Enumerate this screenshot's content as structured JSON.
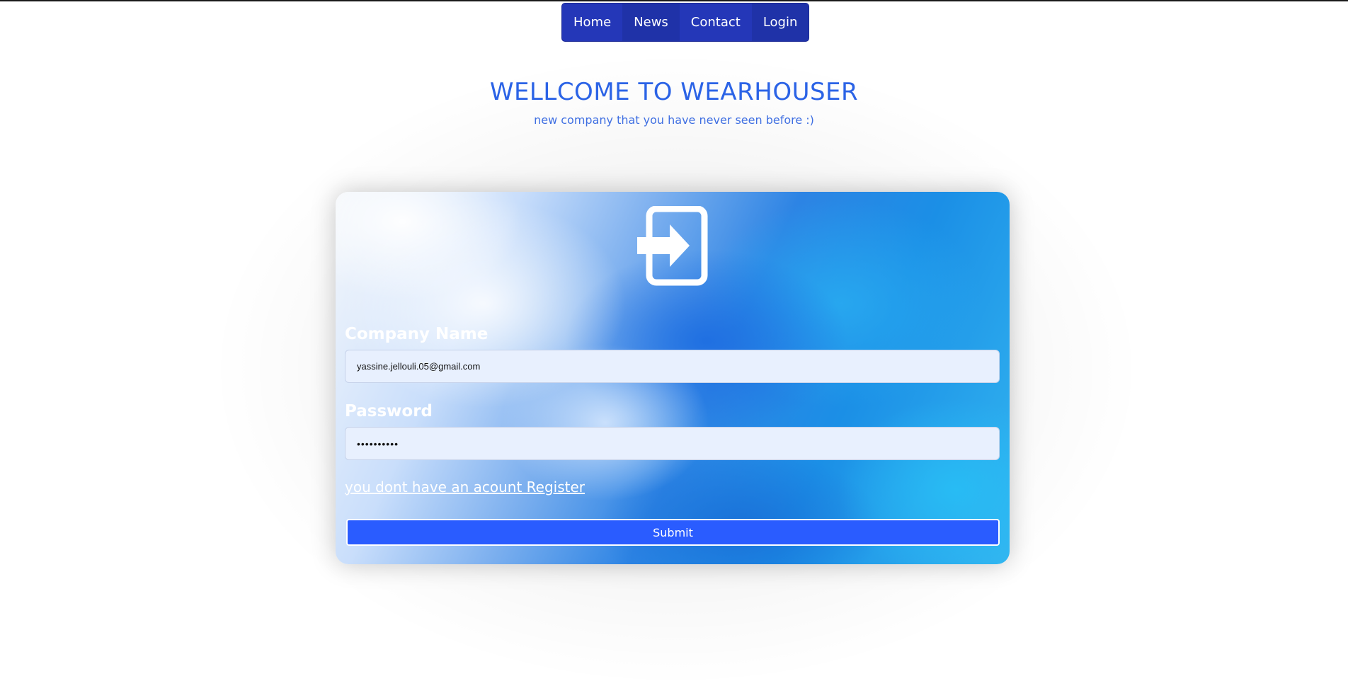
{
  "nav": {
    "items": [
      {
        "label": "Home"
      },
      {
        "label": "News"
      },
      {
        "label": "Contact"
      },
      {
        "label": "Login"
      }
    ]
  },
  "hero": {
    "title": "WELLCOME TO WEARHOUSER",
    "subtitle": "new company that you have never seen before :)"
  },
  "login_card": {
    "icon": "login-icon",
    "company_name": {
      "label": "Company Name",
      "value": "yassine.jellouli.05@gmail.com"
    },
    "password": {
      "label": "Password",
      "value": "••••••••••"
    },
    "register_link": "you dont have an acount Register",
    "submit_label": "Submit"
  },
  "colors": {
    "nav_bg": "#2437b8",
    "heading": "#2b63e6",
    "submit_bg": "#2a5cff",
    "input_bg": "#e8f0fe"
  }
}
